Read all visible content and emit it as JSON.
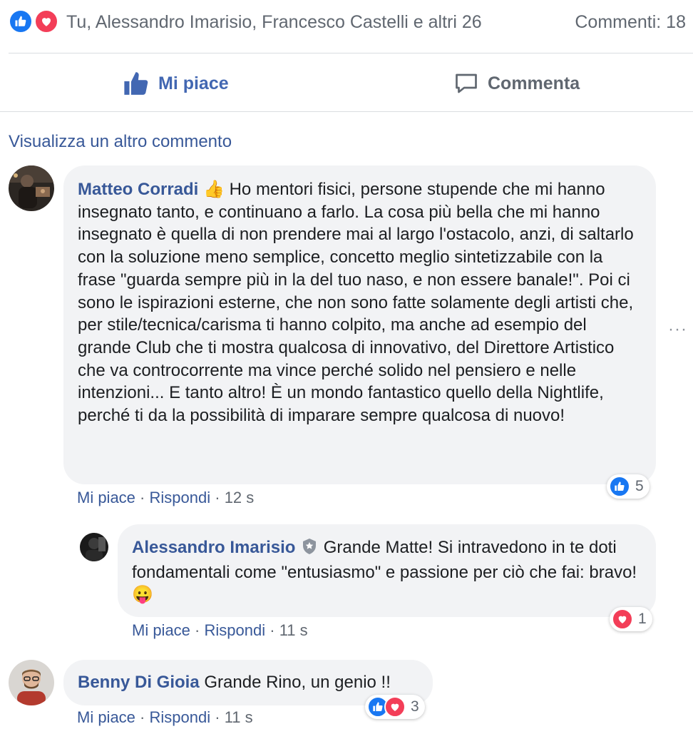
{
  "summary": {
    "reactors": "Tu, Alessandro Imarisio, Francesco Castelli e altri 26",
    "comments": "Commenti: 18",
    "icons": [
      "like-icon",
      "love-icon"
    ]
  },
  "actions": {
    "like": "Mi piace",
    "comment": "Commenta"
  },
  "view_more": "Visualizza un altro commento",
  "comments": [
    {
      "author": "Matteo Corradi",
      "emoji": "👍",
      "text": "Ho mentori fisici, persone stupende che mi hanno insegnato tanto, e continuano a farlo. La cosa più bella che mi hanno insegnato è quella di non prendere mai al largo l'ostacolo, anzi, di saltarlo con la soluzione meno semplice, concetto meglio sintetizzabile con la frase \"guarda sempre più in la del tuo naso, e non essere banale!\". Poi ci sono le ispirazioni esterne, che non sono fatte solamente degli artisti che, per stile/tecnica/carisma ti hanno colpito, ma anche ad esempio del grande Club che ti mostra qualcosa di innovativo, del Direttore Artistico che va controcorrente ma vince perché solido nel pensiero e nelle intenzioni... E tanto altro! È un mondo fantastico quello della Nightlife, perché ti da la possibilità di imparare sempre qualcosa di nuovo!",
      "like": "Mi piace",
      "reply": "Rispondi",
      "time": "12 s",
      "reaction_count": "5"
    },
    {
      "author": "Alessandro Imarisio",
      "text": "Grande Matte! Si intravedono in te doti fondamentali come \"entusiasmo\" e passione per ciò che fai: bravo! 😛",
      "like": "Mi piace",
      "reply": "Rispondi",
      "time": "11 s",
      "reaction_count": "1"
    },
    {
      "author": "Benny Di Gioia",
      "text": "Grande Rino, un genio !!",
      "like": "Mi piace",
      "reply": "Rispondi",
      "time": "11 s",
      "reaction_count": "3"
    }
  ],
  "more_options": "···",
  "meta_sep": "·",
  "colors": {
    "like_blue": "#1877f2",
    "love_red": "#f33e58",
    "link_blue": "#385898",
    "bubble_bg": "#f2f3f5"
  }
}
